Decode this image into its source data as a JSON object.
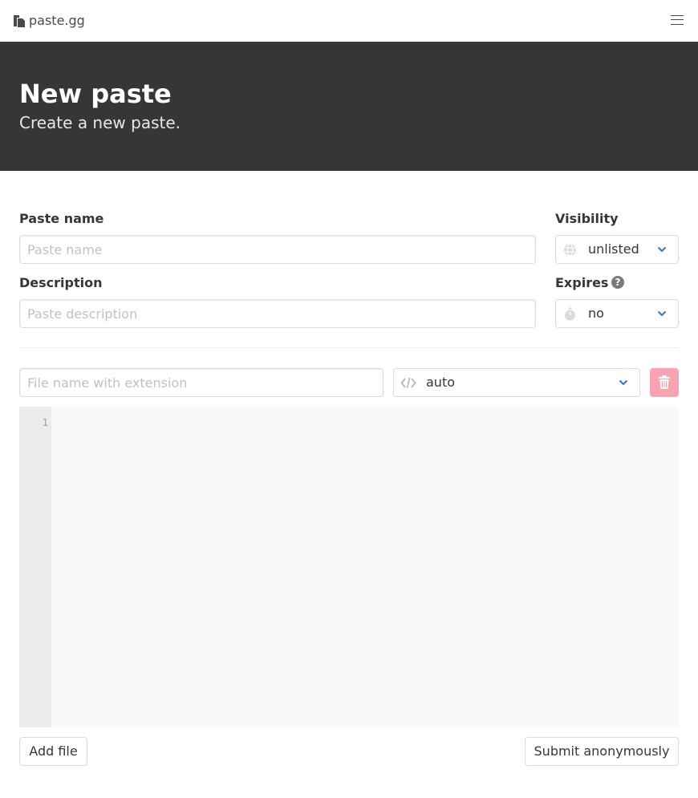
{
  "navbar": {
    "brand": "paste.gg",
    "icons": {
      "logo": "copy-files-icon",
      "menu": "hamburger-menu-icon"
    }
  },
  "hero": {
    "title": "New paste",
    "subtitle": "Create a new paste."
  },
  "form": {
    "paste_name": {
      "label": "Paste name",
      "placeholder": "Paste name",
      "value": ""
    },
    "description": {
      "label": "Description",
      "placeholder": "Paste description",
      "value": ""
    },
    "visibility": {
      "label": "Visibility",
      "value": "unlisted",
      "icon": "globe-icon"
    },
    "expires": {
      "label": "Expires",
      "value": "no",
      "icon": "stopwatch-icon",
      "help": "?"
    }
  },
  "file": {
    "name_placeholder": "File name with extension",
    "name_value": "",
    "language": "auto",
    "language_icon": "code-icon",
    "delete_icon": "trash-icon",
    "line_numbers": [
      "1"
    ]
  },
  "actions": {
    "add_file": "Add file",
    "submit": "Submit anonymously"
  },
  "colors": {
    "hero_bg": "#363636",
    "delete_bg": "#f9a3b2",
    "chevron": "#3273dc",
    "editor_bg": "#f9f9f9",
    "gutter_bg": "#ececec"
  }
}
